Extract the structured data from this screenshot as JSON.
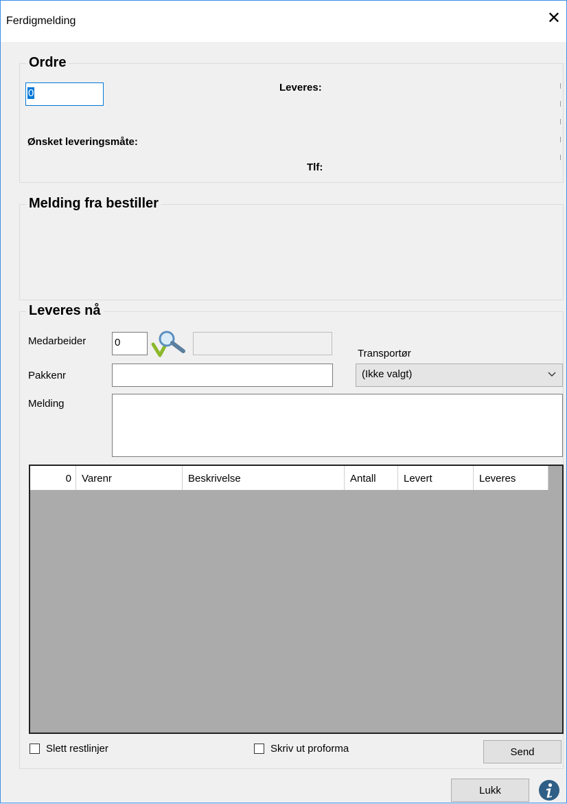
{
  "window": {
    "title": "Ferdigmelding",
    "close_glyph": "✕"
  },
  "ordre": {
    "title": "Ordre",
    "order_number_value": "0",
    "leveres_label": "Leveres:",
    "leveringsmate_label": "Ønsket leveringsmåte:",
    "tlf_label": "Tlf:"
  },
  "melding_fra_bestiller": {
    "title": "Melding fra bestiller"
  },
  "leveres_na": {
    "title": "Leveres nå",
    "medarbeider_label": "Medarbeider",
    "medarbeider_value": "0",
    "medarbeider_name_value": "",
    "pakkenr_label": "Pakkenr",
    "pakkenr_value": "",
    "melding_label": "Melding",
    "melding_value": "",
    "transportor_label": "Transportør",
    "transportor_selected": "(Ikke valgt)",
    "search_icon": "magnifier-check-icon"
  },
  "grid": {
    "columns": [
      "0",
      "Varenr",
      "Beskrivelse",
      "Antall",
      "Levert",
      "Leveres"
    ],
    "rows": []
  },
  "footer": {
    "slett_restlinjer_label": "Slett restlinjer",
    "slett_restlinjer_checked": false,
    "skriv_ut_proforma_label": "Skriv ut proforma",
    "skriv_ut_proforma_checked": false,
    "send_label": "Send",
    "lukk_label": "Lukk",
    "info_icon": "info-icon"
  },
  "colors": {
    "accent": "#0078d7",
    "window_border": "#3a8ee6",
    "grid_bg": "#ababab"
  }
}
